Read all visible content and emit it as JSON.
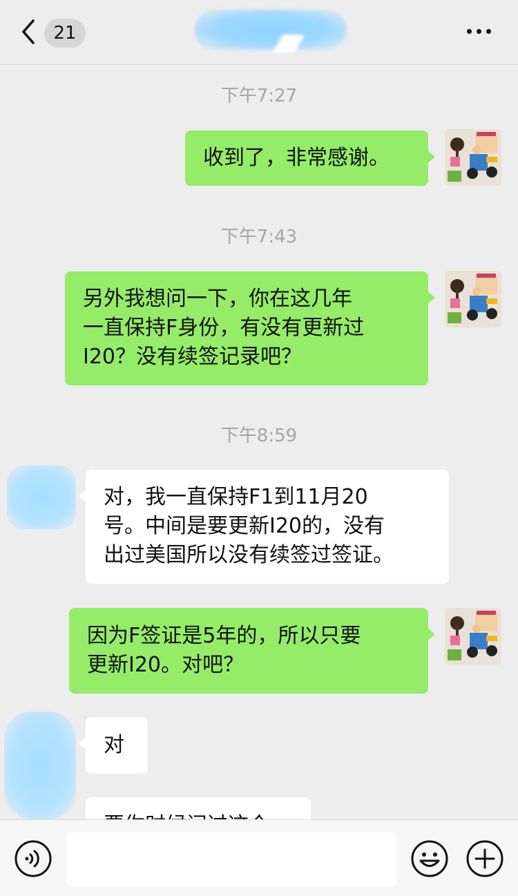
{
  "header": {
    "unread_count": "21",
    "back_icon": "chevron-left-icon",
    "more_icon": "ellipsis-icon"
  },
  "messages": [
    {
      "type": "time",
      "text": "下午7:27"
    },
    {
      "type": "sent",
      "lines": [
        "收到了，非常感谢。"
      ]
    },
    {
      "type": "time",
      "text": "下午7:43"
    },
    {
      "type": "sent",
      "lines": [
        "另外我想问一下，你在这几年",
        "一直保持F身份，有没有更新过",
        "I20？没有续签记录吧？"
      ]
    },
    {
      "type": "time",
      "text": "下午8:59"
    },
    {
      "type": "received",
      "lines": [
        "对，我一直保持F1到11月20",
        "号。中间是要更新I20的，没有",
        "出过美国所以没有续签过签证。"
      ]
    },
    {
      "type": "sent",
      "lines": [
        "因为F签证是5年的，所以只要",
        "更新I20。对吧？"
      ]
    },
    {
      "type": "received",
      "lines": [
        "对"
      ]
    },
    {
      "type": "received",
      "lines": [
        "要你时候问过这个"
      ]
    }
  ],
  "input": {
    "voice_icon": "voice-icon",
    "emoji_icon": "emoji-icon",
    "plus_icon": "plus-icon",
    "value": ""
  },
  "colors": {
    "sent_bubble": "#95ec69",
    "received_bubble": "#ffffff",
    "background": "#ededed"
  }
}
